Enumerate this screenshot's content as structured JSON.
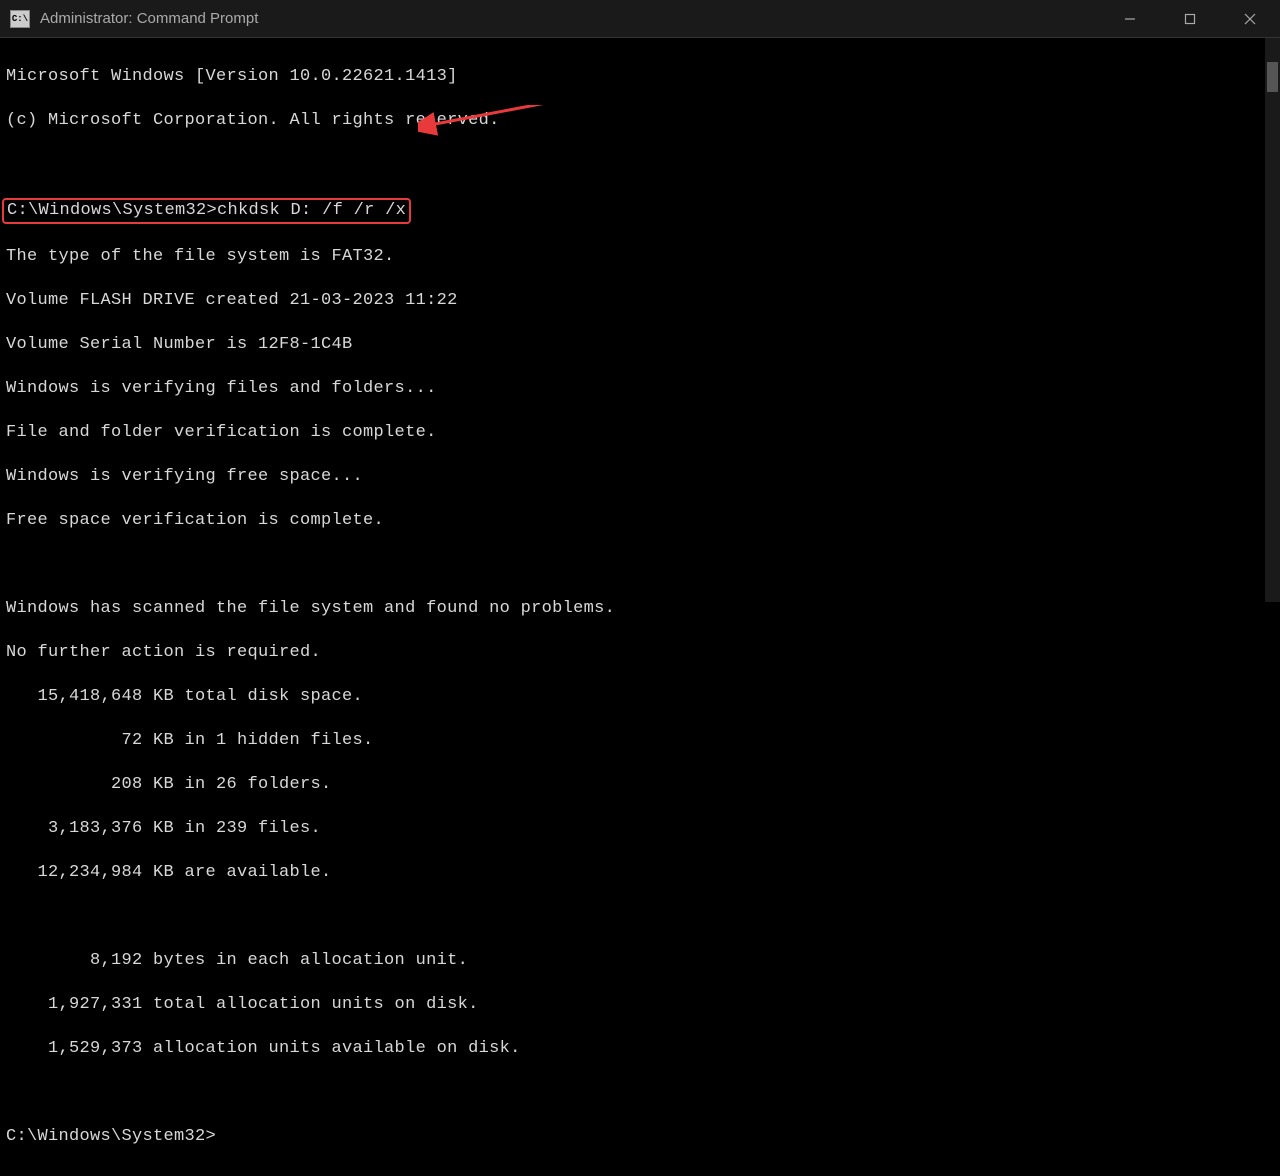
{
  "titlebar": {
    "icon_label": "C:\\",
    "title": "Administrator: Command Prompt"
  },
  "terminal": {
    "line1": "Microsoft Windows [Version 10.0.22621.1413]",
    "line2": "(c) Microsoft Corporation. All rights reserved.",
    "prompt1": "C:\\Windows\\System32>",
    "command": "chkdsk D: /f /r /x",
    "out1": "The type of the file system is FAT32.",
    "out2": "Volume FLASH DRIVE created 21-03-2023 11:22",
    "out3": "Volume Serial Number is 12F8-1C4B",
    "out4": "Windows is verifying files and folders...",
    "out5": "File and folder verification is complete.",
    "out6": "Windows is verifying free space...",
    "out7": "Free space verification is complete.",
    "out8": "Windows has scanned the file system and found no problems.",
    "out9": "No further action is required.",
    "out10": "   15,418,648 KB total disk space.",
    "out11": "           72 KB in 1 hidden files.",
    "out12": "          208 KB in 26 folders.",
    "out13": "    3,183,376 KB in 239 files.",
    "out14": "   12,234,984 KB are available.",
    "out15": "        8,192 bytes in each allocation unit.",
    "out16": "    1,927,331 total allocation units on disk.",
    "out17": "    1,529,373 allocation units available on disk.",
    "prompt2": "C:\\Windows\\System32>"
  },
  "annotation": {
    "color": "#e83a3a"
  }
}
